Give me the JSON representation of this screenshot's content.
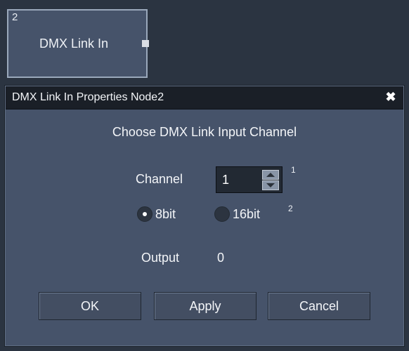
{
  "node": {
    "number": "2",
    "label": "DMX Link In"
  },
  "dialog": {
    "title": "DMX Link In Properties Node2",
    "close_glyph": "✖",
    "heading": "Choose DMX Link Input Channel",
    "channel": {
      "label": "Channel",
      "value": "1",
      "superscript": "1"
    },
    "bit_mode": {
      "options": [
        "8bit",
        "16bit"
      ],
      "selected": "8bit",
      "superscript": "2"
    },
    "output": {
      "label": "Output",
      "value": "0"
    },
    "buttons": {
      "ok": "OK",
      "apply": "Apply",
      "cancel": "Cancel"
    }
  },
  "colors": {
    "background": "#2b3441",
    "panel": "#46536a",
    "titlebar": "#1a1f27"
  }
}
